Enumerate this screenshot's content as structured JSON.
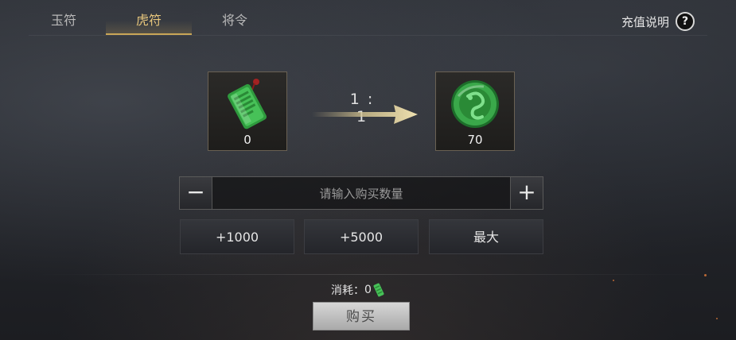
{
  "tabs": [
    {
      "label": "玉符",
      "active": false
    },
    {
      "label": "虎符",
      "active": true
    },
    {
      "label": "将令",
      "active": false
    }
  ],
  "help": {
    "label": "充值说明",
    "icon": "question-icon",
    "icon_glyph": "?"
  },
  "exchange": {
    "source": {
      "icon": "jade-talisman-icon",
      "count": "0"
    },
    "ratio": "1 : 1",
    "target": {
      "icon": "tiger-tally-coin-icon",
      "count": "70"
    }
  },
  "quantity": {
    "minus": "−",
    "placeholder": "请输入购买数量",
    "plus": "+"
  },
  "presets": [
    "+1000",
    "+5000",
    "最大"
  ],
  "cost": {
    "label": "消耗：",
    "value": "0",
    "icon": "jade-talisman-icon"
  },
  "buy_label": "购买",
  "colors": {
    "accent": "#c9a657",
    "jade": "#3fa84a"
  }
}
